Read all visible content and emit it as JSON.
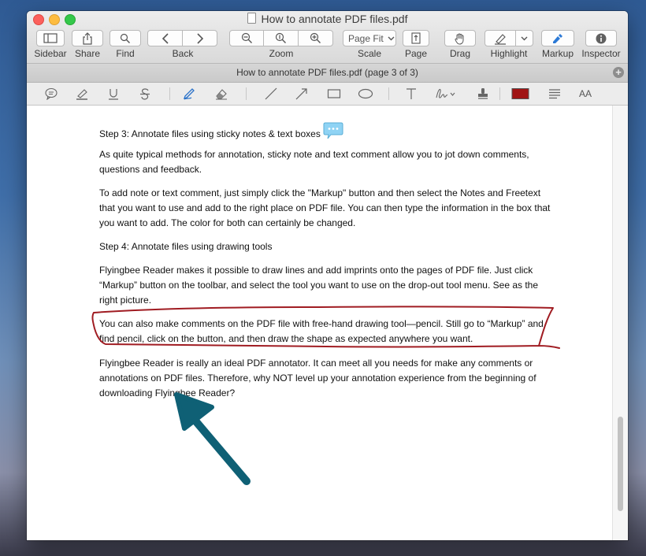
{
  "window": {
    "title": "How to annotate PDF files.pdf"
  },
  "toolbar": {
    "sidebar": "Sidebar",
    "share": "Share",
    "find": "Find",
    "back": "Back",
    "zoom": "Zoom",
    "scale": "Scale",
    "scale_value": "Page Fit",
    "page": "Page",
    "drag": "Drag",
    "highlight": "Highlight",
    "markup": "Markup",
    "inspector": "Inspector"
  },
  "tabbar": {
    "title": "How to annotate PDF files.pdf (page 3 of 3)",
    "add": "+"
  },
  "markup_tools": {
    "color": "#a01414",
    "text_size": "AA"
  },
  "document": {
    "paragraphs": [
      "Step 3: Annotate files using sticky notes & text boxes",
      "As quite typical methods for annotation, sticky note and text comment allow you to jot down comments, questions and feedback.",
      "To add note or text comment, just simply click the \"Markup\" button and then select the Notes and Freetext that you want to use and add to the right place on PDF file. You can then type the information in the box that you want to add. The color for both can certainly be changed.",
      "Step 4: Annotate files using drawing tools",
      "Flyingbee Reader makes it possible to draw lines and add imprints onto the pages of PDF file. Just click “Markup” button on the toolbar, and select the tool you want to use on the drop-out tool menu. See as the right picture.",
      "You can also make comments on the PDF file with free-hand drawing tool—pencil. Still go to “Markup” and find pencil, click on the button, and then draw the shape as expected anywhere you want.",
      "Flyingbee Reader is really an ideal PDF annotator. It can meet all you needs for make any comments or annotations on PDF files. Therefore, why NOT level up your annotation experience from the beginning of downloading Flyingbee Reader?"
    ]
  },
  "annotations": {
    "ink_color": "#a01c22",
    "arrow_color": "#0f6075"
  }
}
